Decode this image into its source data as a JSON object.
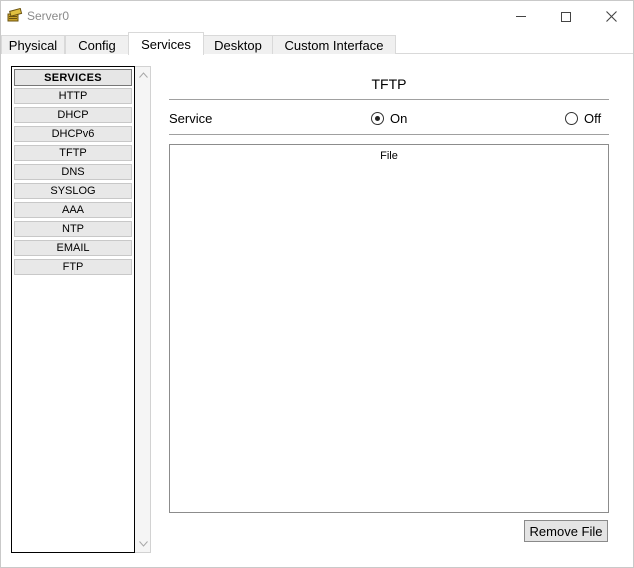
{
  "window": {
    "title": "Server0",
    "icon": "server-app-icon"
  },
  "tabs": [
    {
      "label": "Physical",
      "active": false
    },
    {
      "label": "Config",
      "active": false
    },
    {
      "label": "Services",
      "active": true
    },
    {
      "label": "Desktop",
      "active": false
    },
    {
      "label": "Custom Interface",
      "active": false
    }
  ],
  "sidebar": {
    "header": "SERVICES",
    "items": [
      "HTTP",
      "DHCP",
      "DHCPv6",
      "TFTP",
      "DNS",
      "SYSLOG",
      "AAA",
      "NTP",
      "EMAIL",
      "FTP"
    ]
  },
  "panel": {
    "title": "TFTP",
    "service_label": "Service",
    "on_label": "On",
    "off_label": "Off",
    "selected": "On",
    "file_column": "File",
    "remove_button": "Remove File"
  }
}
